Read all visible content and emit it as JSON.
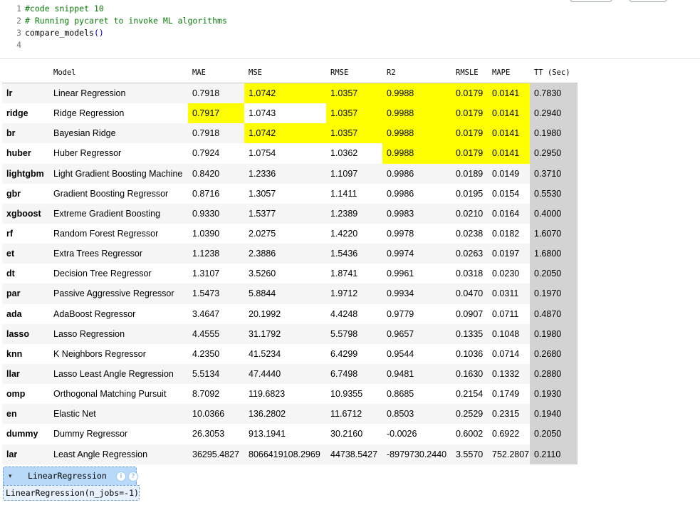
{
  "code": {
    "lines": [
      {
        "no": "1",
        "text": "#code snippet 10"
      },
      {
        "no": "2",
        "text": "# Running pycaret to invoke ML algorithms"
      },
      {
        "no": "3",
        "text": "compare_models",
        "paren_open": "(",
        "paren_close": ")"
      },
      {
        "no": "4",
        "text": ""
      }
    ]
  },
  "table": {
    "headers": [
      "",
      "Model",
      "MAE",
      "MSE",
      "RMSE",
      "R2",
      "RMSLE",
      "MAPE",
      "TT (Sec)"
    ],
    "rows": [
      {
        "id": "lr",
        "cells": [
          "Linear Regression",
          "0.7918",
          "1.0742",
          "1.0357",
          "0.9988",
          "0.0179",
          "0.0141",
          "0.7830"
        ]
      },
      {
        "id": "ridge",
        "cells": [
          "Ridge Regression",
          "0.7917",
          "1.0743",
          "1.0357",
          "0.9988",
          "0.0179",
          "0.0141",
          "0.2940"
        ]
      },
      {
        "id": "br",
        "cells": [
          "Bayesian Ridge",
          "0.7918",
          "1.0742",
          "1.0357",
          "0.9988",
          "0.0179",
          "0.0141",
          "0.1980"
        ]
      },
      {
        "id": "huber",
        "cells": [
          "Huber Regressor",
          "0.7924",
          "1.0754",
          "1.0362",
          "0.9988",
          "0.0179",
          "0.0141",
          "0.2950"
        ]
      },
      {
        "id": "lightgbm",
        "cells": [
          "Light Gradient Boosting Machine",
          "0.8420",
          "1.2336",
          "1.1097",
          "0.9986",
          "0.0189",
          "0.0149",
          "0.3710"
        ]
      },
      {
        "id": "gbr",
        "cells": [
          "Gradient Boosting Regressor",
          "0.8716",
          "1.3057",
          "1.1411",
          "0.9986",
          "0.0195",
          "0.0154",
          "0.5530"
        ]
      },
      {
        "id": "xgboost",
        "cells": [
          "Extreme Gradient Boosting",
          "0.9330",
          "1.5377",
          "1.2389",
          "0.9983",
          "0.0210",
          "0.0164",
          "0.4000"
        ]
      },
      {
        "id": "rf",
        "cells": [
          "Random Forest Regressor",
          "1.0390",
          "2.0275",
          "1.4220",
          "0.9978",
          "0.0238",
          "0.0182",
          "1.6070"
        ]
      },
      {
        "id": "et",
        "cells": [
          "Extra Trees Regressor",
          "1.1238",
          "2.3886",
          "1.5436",
          "0.9974",
          "0.0263",
          "0.0197",
          "1.6800"
        ]
      },
      {
        "id": "dt",
        "cells": [
          "Decision Tree Regressor",
          "1.3107",
          "3.5260",
          "1.8741",
          "0.9961",
          "0.0318",
          "0.0230",
          "0.2050"
        ]
      },
      {
        "id": "par",
        "cells": [
          "Passive Aggressive Regressor",
          "1.5473",
          "5.8844",
          "1.9712",
          "0.9934",
          "0.0470",
          "0.0311",
          "0.1970"
        ]
      },
      {
        "id": "ada",
        "cells": [
          "AdaBoost Regressor",
          "3.4647",
          "20.1992",
          "4.4248",
          "0.9779",
          "0.0907",
          "0.0711",
          "0.4870"
        ]
      },
      {
        "id": "lasso",
        "cells": [
          "Lasso Regression",
          "4.4555",
          "31.1792",
          "5.5798",
          "0.9657",
          "0.1335",
          "0.1048",
          "0.1980"
        ]
      },
      {
        "id": "knn",
        "cells": [
          "K Neighbors Regressor",
          "4.2350",
          "41.5234",
          "6.4299",
          "0.9544",
          "0.1036",
          "0.0714",
          "0.2680"
        ]
      },
      {
        "id": "llar",
        "cells": [
          "Lasso Least Angle Regression",
          "5.5134",
          "47.4440",
          "6.7498",
          "0.9481",
          "0.1630",
          "0.1332",
          "0.2880"
        ]
      },
      {
        "id": "omp",
        "cells": [
          "Orthogonal Matching Pursuit",
          "8.7092",
          "119.6823",
          "10.9355",
          "0.8685",
          "0.2154",
          "0.1749",
          "0.1930"
        ]
      },
      {
        "id": "en",
        "cells": [
          "Elastic Net",
          "10.0366",
          "136.2802",
          "11.6712",
          "0.8503",
          "0.2529",
          "0.2315",
          "0.1940"
        ]
      },
      {
        "id": "dummy",
        "cells": [
          "Dummy Regressor",
          "26.3053",
          "913.1941",
          "30.2160",
          "-0.0026",
          "0.6002",
          "0.6922",
          "0.2050"
        ]
      },
      {
        "id": "lar",
        "cells": [
          "Least Angle Regression",
          "36295.4827",
          "8066419108.2969",
          "44738.5427",
          "-8979730.2440",
          "3.5570",
          "752.2807",
          "0.2110"
        ]
      }
    ],
    "highlight_color": "#ffff00",
    "tt_color": "#d3d3d3"
  },
  "estimator": {
    "title": "LinearRegression",
    "repr": "LinearRegression(n_jobs=-1)",
    "arrow": "▾",
    "info_glyph": "i",
    "help_glyph": "?"
  }
}
